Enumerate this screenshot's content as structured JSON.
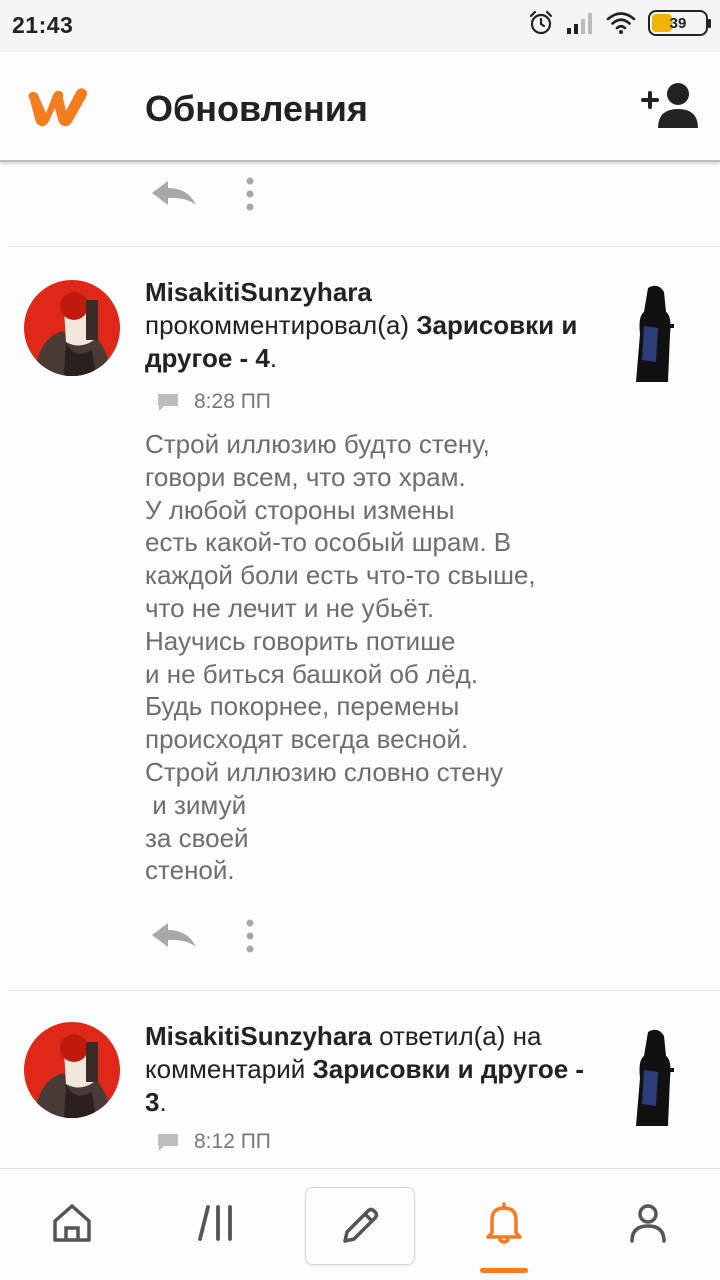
{
  "status_bar": {
    "time": "21:43",
    "battery": "39",
    "battery_level": 0.39
  },
  "header": {
    "title": "Обновления"
  },
  "icons": {
    "logo": "wattpad-logo",
    "add_user": "add-user-icon",
    "reply": "reply-icon",
    "more": "more-vert-icon",
    "comment": "comment-icon",
    "home": "home-icon",
    "library": "library-icon",
    "write": "pencil-icon",
    "notifications": "bell-icon",
    "profile": "person-icon"
  },
  "notifications": [
    {
      "user": "MisakitiSunzyhara",
      "action": "прокомментировал(а)",
      "story": "Зарисовки и другое - 4",
      "suffix": ".",
      "time": "8:28 ПП",
      "comment": "Строй иллюзию будто стену,\nговори всем, что это храм.\nУ любой стороны измены\nесть какой-то особый шрам. В\nкаждой боли есть что-то свыше,\nчто не лечит и не убьёт.\nНаучись говорить потише\nи не биться башкой об лёд.\nБудь покорнее, перемены\nпроисходят всегда весной.\nСтрой иллюзию словно стену\n и зимуй\nза своей\nстеной."
    },
    {
      "user": "MisakitiSunzyhara",
      "action": "ответил(а) на комментарий",
      "story": "Зарисовки и другое - 3",
      "suffix": ".",
      "time": "8:12 ПП"
    }
  ],
  "colors": {
    "accent": "#f57c1f",
    "text_primary": "#222222",
    "text_secondary": "#6e6e6e",
    "icon_gray": "#a8a8a8"
  }
}
